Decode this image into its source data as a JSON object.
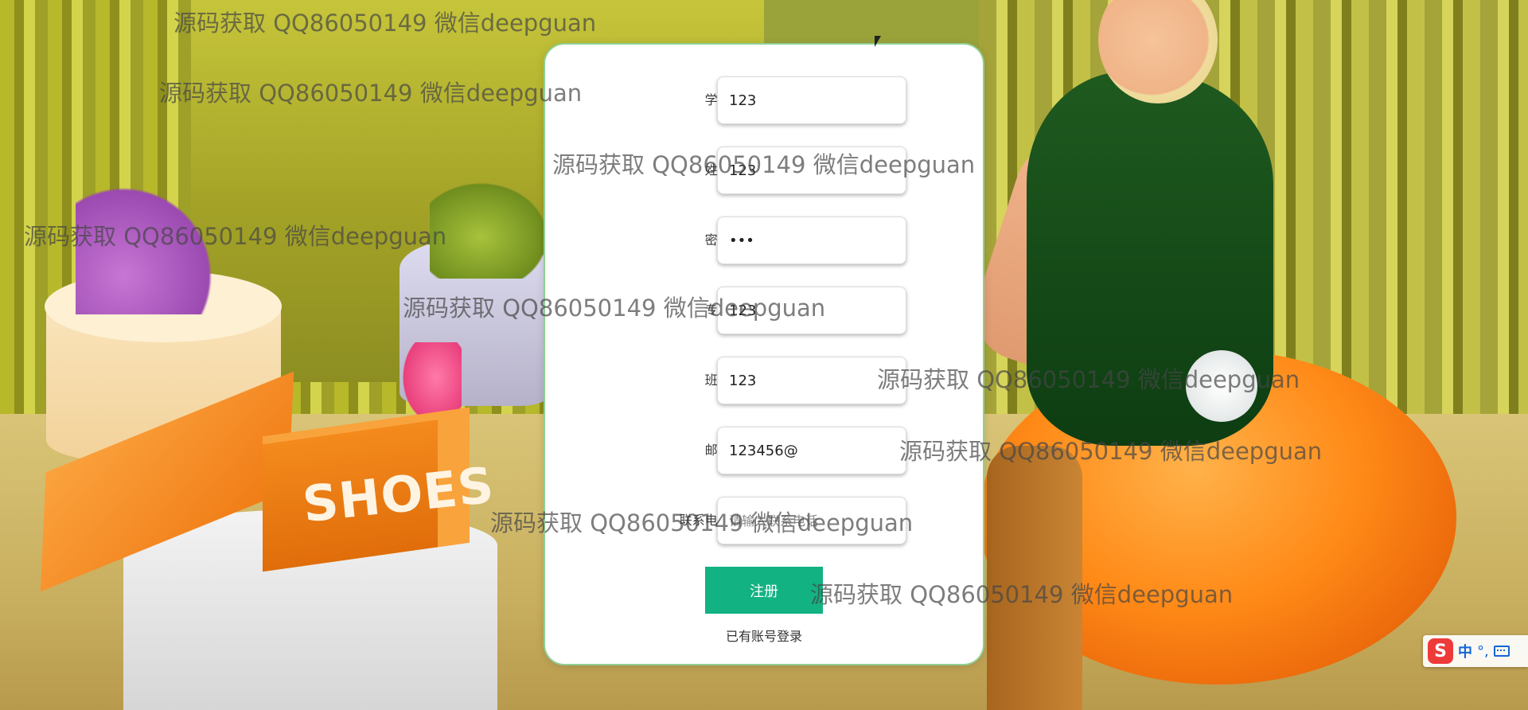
{
  "form": {
    "fields": [
      {
        "label": "学号:",
        "value": "123",
        "type": "text",
        "placeholder": ""
      },
      {
        "label": "姓名:",
        "value": "123",
        "type": "text",
        "placeholder": ""
      },
      {
        "label": "密码:",
        "value": "123",
        "type": "password",
        "placeholder": ""
      },
      {
        "label": "专业:",
        "value": "123",
        "type": "text",
        "placeholder": ""
      },
      {
        "label": "班级:",
        "value": "123",
        "type": "text",
        "placeholder": ""
      },
      {
        "label": "邮箱:",
        "value": "123456@",
        "type": "text",
        "placeholder": ""
      },
      {
        "label": "联系电话:",
        "value": "",
        "type": "text",
        "placeholder": "请输入联系电话"
      }
    ],
    "submit_label": "注册",
    "login_link": "已有账号登录"
  },
  "background": {
    "box_label": "SHOES"
  },
  "watermarks": [
    "源码获取 QQ86050149 微信deepguan",
    "源码获取 QQ86050149 微信deepguan",
    "源码获取 QQ86050149 微信deepguan",
    "源码获取 QQ86050149 微信deepguan",
    "源码获取 QQ86050149 微信deepguan",
    "源码获取 QQ86050149 微信deepguan",
    "源码获取 QQ86050149 微信deepguan",
    "源码获取 QQ86050149 微信deepguan",
    "源码获取 QQ86050149 微信deepguan"
  ],
  "ime": {
    "logo": "S",
    "lang": "中",
    "punct": "°,",
    "keyboard_icon": "keyboard-icon"
  },
  "colors": {
    "accent": "#12b283",
    "card_border": "#8fcf93"
  }
}
